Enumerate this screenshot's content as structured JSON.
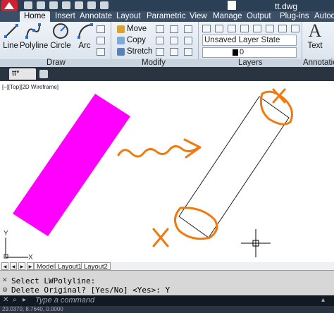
{
  "window": {
    "title": "tt.dwg"
  },
  "ribbon_tabs": [
    {
      "label": "Home",
      "active": true
    },
    {
      "label": "Insert"
    },
    {
      "label": "Annotate"
    },
    {
      "label": "Layout"
    },
    {
      "label": "Parametric"
    },
    {
      "label": "View"
    },
    {
      "label": "Manage"
    },
    {
      "label": "Output"
    },
    {
      "label": "Plug-ins"
    },
    {
      "label": "Autod"
    }
  ],
  "draw_panel": {
    "title": "Draw",
    "tools": [
      {
        "label": "Line",
        "icon": "line-icon"
      },
      {
        "label": "Polyline",
        "icon": "polyline-icon"
      },
      {
        "label": "Circle",
        "icon": "circle-icon"
      },
      {
        "label": "Arc",
        "icon": "arc-icon"
      }
    ]
  },
  "modify_panel": {
    "title": "Modify",
    "tools": [
      {
        "label": "Move",
        "icon": "move-icon"
      },
      {
        "label": "Copy",
        "icon": "copy-icon"
      },
      {
        "label": "Stretch",
        "icon": "stretch-icon"
      }
    ]
  },
  "layers_panel": {
    "title": "Layers",
    "layer_state": "Unsaved Layer State",
    "current_layer": "0"
  },
  "annotation_panel": {
    "title": "Annotatio",
    "tools": [
      {
        "label": "Text",
        "icon": "text-icon"
      }
    ]
  },
  "file_tab": {
    "label": "tt*"
  },
  "viewport_label": "[–][Top][2D Wireframe]",
  "layout_tabs": [
    "Model",
    "Layout1",
    "Layout2"
  ],
  "command_history": [
    "Select LWPolyline:",
    "Delete Original? [Yes/No] <Yes>: Y"
  ],
  "command_input": {
    "placeholder": "Type a command"
  },
  "status_bar": {
    "coordinates": "29.0370, 8.7640, 0.0000"
  },
  "colors": {
    "accent": "#ff00ff",
    "annotation": "#f07a10",
    "titlebar": "#2b3f55"
  }
}
